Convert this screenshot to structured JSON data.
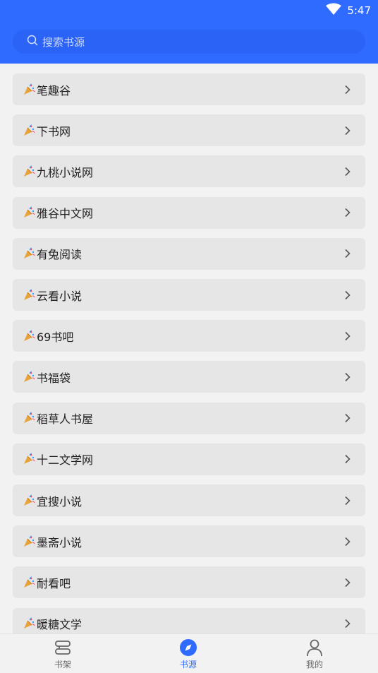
{
  "status": {
    "time": "5:47"
  },
  "search": {
    "placeholder": "搜索书源"
  },
  "sources": [
    "笔趣谷",
    "下书网",
    "九桃小说网",
    "雅谷中文网",
    "有兔阅读",
    "云看小说",
    "69书吧",
    "书福袋",
    "稻草人书屋",
    "十二文学网",
    "宜搜小说",
    "墨斋小说",
    "耐看吧",
    "暖糖文学"
  ],
  "tabs": [
    {
      "label": "书架",
      "icon": "bookshelf-icon",
      "active": false
    },
    {
      "label": "书源",
      "icon": "compass-icon",
      "active": true
    },
    {
      "label": "我的",
      "icon": "person-icon",
      "active": false
    }
  ],
  "colors": {
    "accent": "#2f6bff",
    "item_bg": "#e6e6e6",
    "page_bg": "#f2f2f2"
  }
}
